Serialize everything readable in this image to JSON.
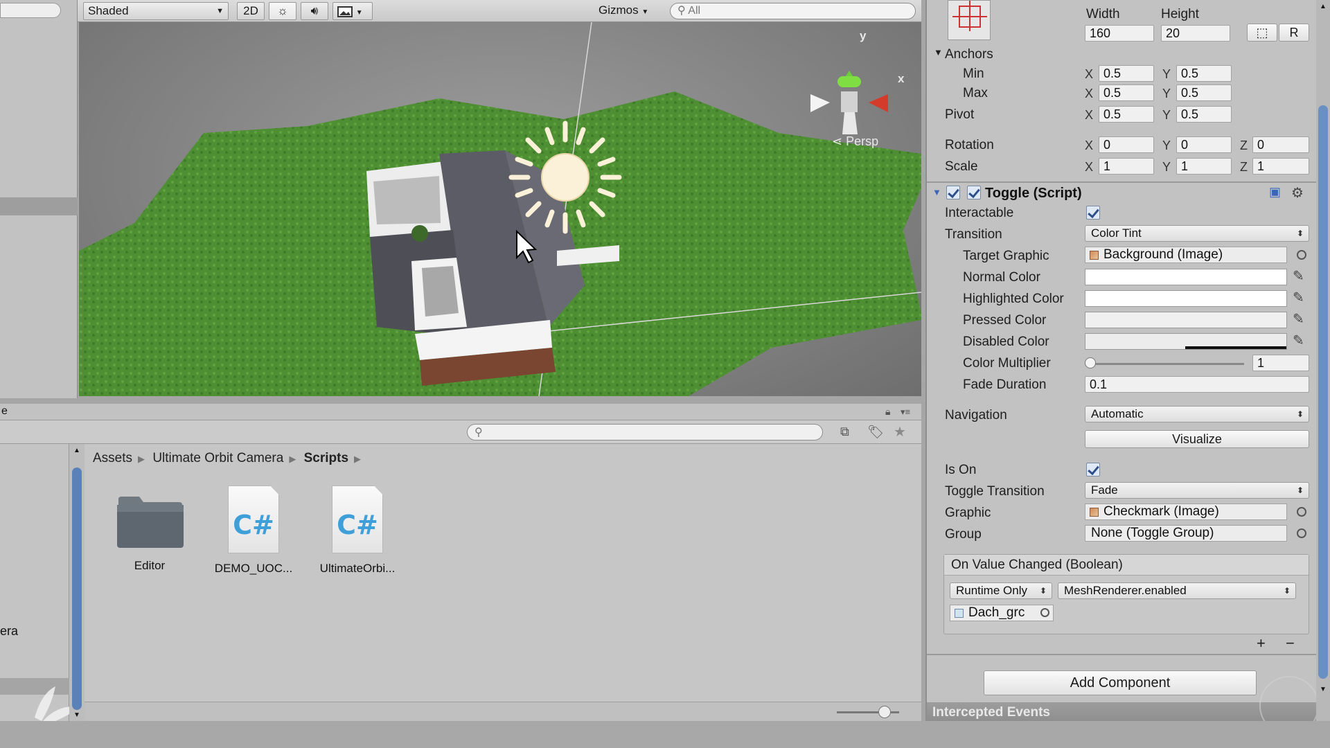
{
  "scene_toolbar": {
    "shading_mode": "Shaded",
    "mode_2d": "2D",
    "gizmos_label": "Gizmos",
    "search_placeholder": "All"
  },
  "scene_view": {
    "gizmo_y_axis": "y",
    "gizmo_x_axis": "x",
    "projection_label": "Persp"
  },
  "project_panel": {
    "tab_fragment": "e",
    "tree_fragment": "era",
    "breadcrumb": [
      "Assets",
      "Ultimate Orbit Camera",
      "Scripts"
    ],
    "assets": [
      {
        "label": "Editor",
        "type": "folder"
      },
      {
        "label": "DEMO_UOC...",
        "type": "csharp"
      },
      {
        "label": "UltimateOrbi...",
        "type": "csharp"
      }
    ]
  },
  "inspector": {
    "rect": {
      "width_label": "Width",
      "height_label": "Height",
      "width": "160",
      "height": "20",
      "r_button": "R",
      "anchors_label": "Anchors",
      "min_label": "Min",
      "max_label": "Max",
      "anchor_min_x": "0.5",
      "anchor_min_y": "0.5",
      "anchor_max_x": "0.5",
      "anchor_max_y": "0.5",
      "pivot_label": "Pivot",
      "pivot_x": "0.5",
      "pivot_y": "0.5",
      "rotation_label": "Rotation",
      "rot_x": "0",
      "rot_y": "0",
      "rot_z": "0",
      "scale_label": "Scale",
      "scale_x": "1",
      "scale_y": "1",
      "scale_z": "1",
      "x": "X",
      "y": "Y",
      "z": "Z"
    },
    "toggle": {
      "title": "Toggle (Script)",
      "interactable_label": "Interactable",
      "transition_label": "Transition",
      "transition": "Color Tint",
      "target_graphic_label": "Target Graphic",
      "target_graphic": "Background (Image)",
      "normal_color_label": "Normal Color",
      "highlighted_color_label": "Highlighted Color",
      "pressed_color_label": "Pressed Color",
      "disabled_color_label": "Disabled Color",
      "color_multiplier_label": "Color Multiplier",
      "color_multiplier": "1",
      "fade_duration_label": "Fade Duration",
      "fade_duration": "0.1",
      "navigation_label": "Navigation",
      "navigation": "Automatic",
      "visualize_button": "Visualize",
      "is_on_label": "Is On",
      "toggle_transition_label": "Toggle Transition",
      "toggle_transition": "Fade",
      "graphic_label": "Graphic",
      "graphic": "Checkmark (Image)",
      "group_label": "Group",
      "group": "None (Toggle Group)",
      "event_title": "On Value Changed (Boolean)",
      "event_runtime": "Runtime Only",
      "event_function": "MeshRenderer.enabled",
      "event_object": "Dach_grc",
      "add_listener": "+",
      "remove_listener": "−"
    },
    "add_component_button": "Add Component",
    "intercepted_events": "Intercepted Events",
    "colors": {
      "accent": "#2c4f8a",
      "csharp": "#3f9fd8"
    }
  }
}
